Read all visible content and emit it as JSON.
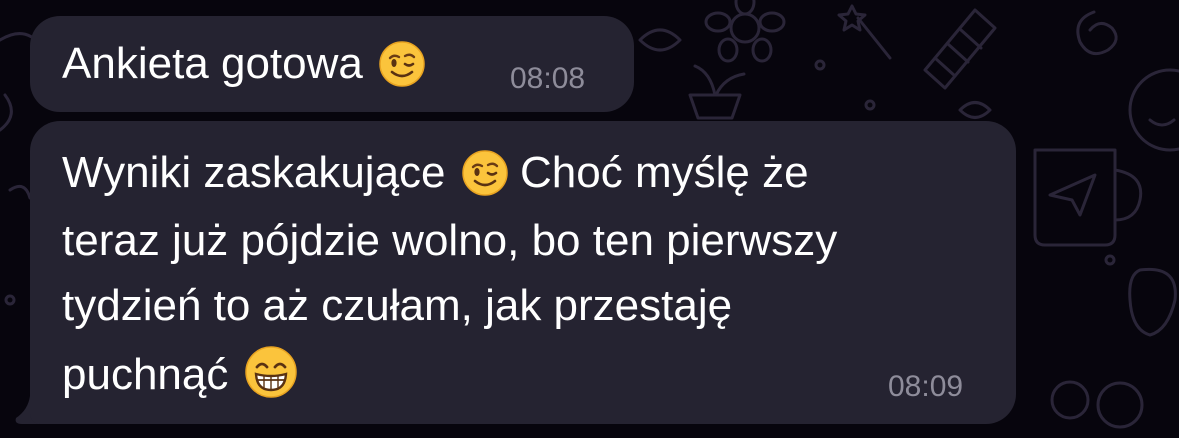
{
  "colors": {
    "background": "#07050d",
    "bubble": "#252331",
    "text": "#ffffff",
    "timestamp": "#8e8c9a"
  },
  "messages": [
    {
      "text": "Ankieta gotowa",
      "trailing_emoji": "winking-face-emoji",
      "time": "08:08"
    },
    {
      "lines": [
        "Wyniki zaskakujące",
        "Choć myślę że",
        "teraz już pójdzie wolno, bo ten pierwszy",
        "tydzień to aż czułam, jak przestaję",
        "puchnąć"
      ],
      "emojis": [
        "winking-face-emoji",
        "grinning-face-emoji"
      ],
      "time": "08:09"
    }
  ]
}
